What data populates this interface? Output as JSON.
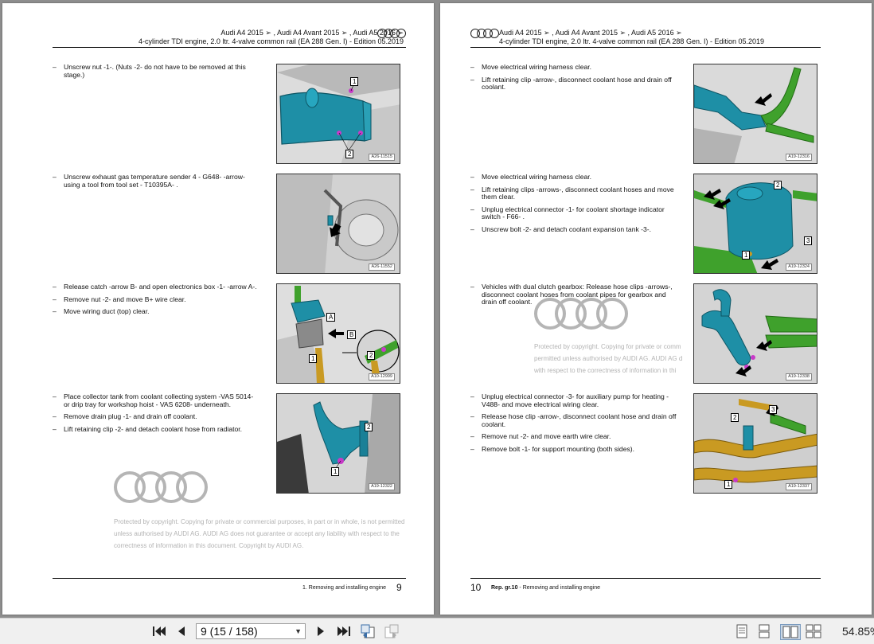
{
  "left_page": {
    "header_line1": "Audi A4 2015 ➢ , Audi A4 Avant 2015 ➢ , Audi A5 2016 ➢",
    "header_line2": "4-cylinder TDI engine, 2.0 ltr. 4-valve common rail (EA 288 Gen. I) - Edition 05.2019",
    "sections": [
      {
        "items": [
          "Unscrew nut -1-. (Nuts -2- do not have to be removed at this stage.)"
        ],
        "figure_id": "A26-11515",
        "callouts": [
          "1",
          "2"
        ]
      },
      {
        "items": [
          "Unscrew exhaust gas temperature sender 4 - G648- -arrow- using a tool from tool set - T10395A- ."
        ],
        "figure_id": "A26-11552",
        "callouts": []
      },
      {
        "items": [
          "Release catch -arrow B- and open electronics box -1- -arrow A-.",
          "Remove nut -2- and move B+ wire clear.",
          "Move wiring duct (top) clear."
        ],
        "figure_id": "A10-12999",
        "callouts": [
          "A",
          "B",
          "1",
          "2"
        ]
      },
      {
        "items": [
          "Place collector tank from coolant collecting system -VAS 5014- or drip tray for workshop hoist - VAS 6208- underneath.",
          "Remove drain plug -1- and drain off coolant.",
          "Lift retaining clip -2- and detach coolant hose from radiator."
        ],
        "figure_id": "A19-12322",
        "callouts": [
          "1",
          "2"
        ]
      }
    ],
    "watermark": "Protected by copyright. Copying for private or commercial purposes, in part or in whole, is not permitted unless authorised by AUDI AG. AUDI AG does not guarantee or accept any liability with respect to the correctness of information in this document. Copyright by AUDI AG.",
    "footer_title": "1. Removing and installing engine",
    "page_number": "9"
  },
  "right_page": {
    "header_line1": "Audi A4 2015 ➢ , Audi A4 Avant 2015 ➢ , Audi A5 2016 ➢",
    "header_line2": "4-cylinder TDI engine, 2.0 ltr. 4-valve common rail (EA 288 Gen. I) - Edition 05.2019",
    "sections": [
      {
        "items": [
          "Move electrical wiring harness clear.",
          "Lift retaining clip -arrow-, disconnect coolant hose and drain off coolant."
        ],
        "figure_id": "A19-12316",
        "callouts": []
      },
      {
        "items": [
          "Move electrical wiring harness clear.",
          "Lift retaining clips -arrows-, disconnect coolant hoses and move them clear.",
          "Unplug electrical connector -1- for coolant shortage indicator switch - F66- .",
          "Unscrew bolt -2- and detach coolant expansion tank -3-."
        ],
        "figure_id": "A19-12324",
        "callouts": [
          "1",
          "2",
          "3"
        ]
      },
      {
        "items": [
          "Vehicles with dual clutch gearbox: Release hose clips -arrows-, disconnect coolant hoses from coolant pipes for gearbox and drain off coolant."
        ],
        "figure_id": "A19-12338",
        "callouts": []
      },
      {
        "items": [
          "Unplug electrical connector -3- for auxiliary pump for heating - V488- and move electrical wiring clear.",
          "Release hose clip -arrow-, disconnect coolant hose and drain off coolant.",
          "Remove nut -2- and move earth wire clear.",
          "Remove bolt -1- for support mounting (both sides)."
        ],
        "figure_id": "A19-12337",
        "callouts": [
          "1",
          "2",
          "3"
        ]
      }
    ],
    "watermark": "Protected by copyright. Copying for private or comm permitted unless authorised by AUDI AG. AUDI AG d with respect to the correctness of information in thi",
    "footer_title_prefix": "Rep. gr.10",
    "footer_title": " - Removing and installing engine",
    "page_number": "10"
  },
  "toolbar": {
    "page_select_value": "9 (15 / 158)",
    "zoom": "54.85%",
    "icons": [
      "first-page-icon",
      "previous-page-icon",
      "next-page-icon",
      "last-page-icon",
      "go-back-icon",
      "go-forward-icon",
      "single-page-view-icon",
      "continuous-view-icon",
      "two-page-view-icon",
      "two-page-continuous-view-icon"
    ]
  }
}
